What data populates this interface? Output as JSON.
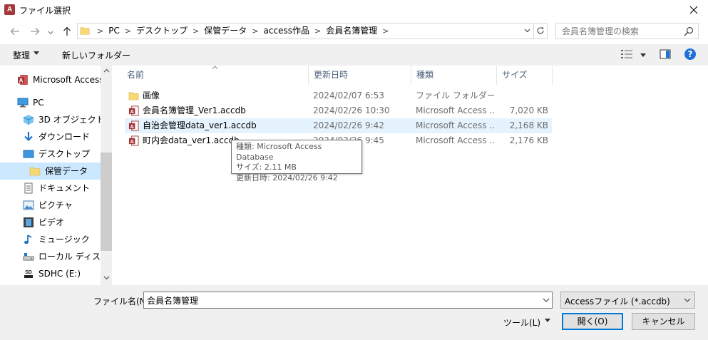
{
  "window": {
    "title": "ファイル選択",
    "app_icon_letter": "A"
  },
  "address": {
    "crumbs": [
      "PC",
      "デスクトップ",
      "保管データ",
      "access作品",
      "会員名簿管理"
    ]
  },
  "search": {
    "placeholder": "会員名簿管理の検索"
  },
  "toolbar": {
    "organize_label": "整理",
    "new_folder_label": "新しいフォルダー"
  },
  "nav": {
    "items": [
      {
        "label": "Microsoft Access",
        "icon": "access-icon"
      },
      {
        "label": "PC",
        "icon": "pc-icon"
      },
      {
        "label": "3D オブジェクト",
        "icon": "3d-objects-icon"
      },
      {
        "label": "ダウンロード",
        "icon": "download-icon"
      },
      {
        "label": "デスクトップ",
        "icon": "desktop-icon"
      },
      {
        "label": "保管データ",
        "icon": "folder-icon",
        "selected": true
      },
      {
        "label": "ドキュメント",
        "icon": "document-icon"
      },
      {
        "label": "ピクチャ",
        "icon": "pictures-icon"
      },
      {
        "label": "ビデオ",
        "icon": "video-icon"
      },
      {
        "label": "ミュージック",
        "icon": "music-icon"
      },
      {
        "label": "ローカル ディスク (C",
        "icon": "disk-icon"
      },
      {
        "label": "SDHC (E:)",
        "icon": "sd-card-icon"
      }
    ]
  },
  "columns": {
    "name": "名前",
    "date": "更新日時",
    "type": "種類",
    "size": "サイズ"
  },
  "files": [
    {
      "name": "画像",
      "date": "2024/02/07 6:53",
      "type": "ファイル フォルダー",
      "size": "",
      "icon": "folder-icon"
    },
    {
      "name": "会員名簿管理_Ver1.accdb",
      "date": "2024/02/26 10:30",
      "type": "Microsoft Access ...",
      "size": "7,020 KB",
      "icon": "access-file-icon"
    },
    {
      "name": "自治会管理data_ver1.accdb",
      "date": "2024/02/26 9:42",
      "type": "Microsoft Access ...",
      "size": "2,168 KB",
      "icon": "access-file-icon",
      "hover": true
    },
    {
      "name": "町内会data_ver1.accdb",
      "date": "2024/02/26 9:45",
      "type": "Microsoft Access ...",
      "size": "2,176 KB",
      "icon": "access-file-icon"
    }
  ],
  "tooltip": {
    "line1": "種類: Microsoft Access Database",
    "line2": "サイズ: 2.11 MB",
    "line3": "更新日時: 2024/02/26 9:42"
  },
  "bottom": {
    "filename_label": "ファイル名(N):",
    "filename_value": "会員名簿管理",
    "filter_value": "Accessファイル (*.accdb)",
    "tools_label": "ツール(L)",
    "open_label": "開く(O)",
    "cancel_label": "キャンセル"
  },
  "colors": {
    "accent": "#0078d7",
    "selected_bg": "#cce8ff",
    "hover_bg": "#e5f3ff",
    "access_red": "#a4373a",
    "folder_yellow": "#f8d775"
  }
}
